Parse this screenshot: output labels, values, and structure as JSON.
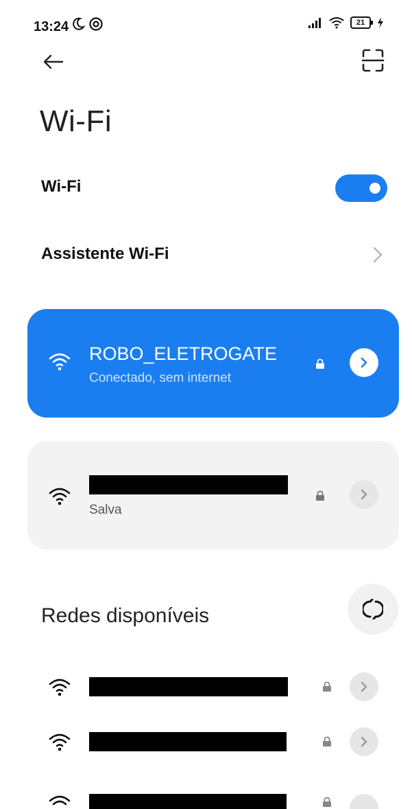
{
  "status_bar": {
    "time": "13:24",
    "battery": "21",
    "icons_left": [
      "moon-icon",
      "do-not-disturb-icon"
    ],
    "icons_right": [
      "signal-icon",
      "wifi-icon",
      "battery-icon",
      "charging-icon"
    ]
  },
  "header": {
    "back_icon": "arrow-left-icon",
    "scan_icon": "scan-icon",
    "title": "Wi-Fi"
  },
  "settings": {
    "wifi_label": "Wi-Fi",
    "wifi_enabled": true,
    "assistant_label": "Assistente Wi-Fi"
  },
  "connected_network": {
    "name": "ROBO_ELETROGATE",
    "status": "Conectado, sem internet"
  },
  "saved_network": {
    "status": "Salva"
  },
  "available": {
    "title": "Redes disponíveis"
  },
  "colors": {
    "accent": "#1a7ef0",
    "card_bg": "#f3f3f3"
  }
}
